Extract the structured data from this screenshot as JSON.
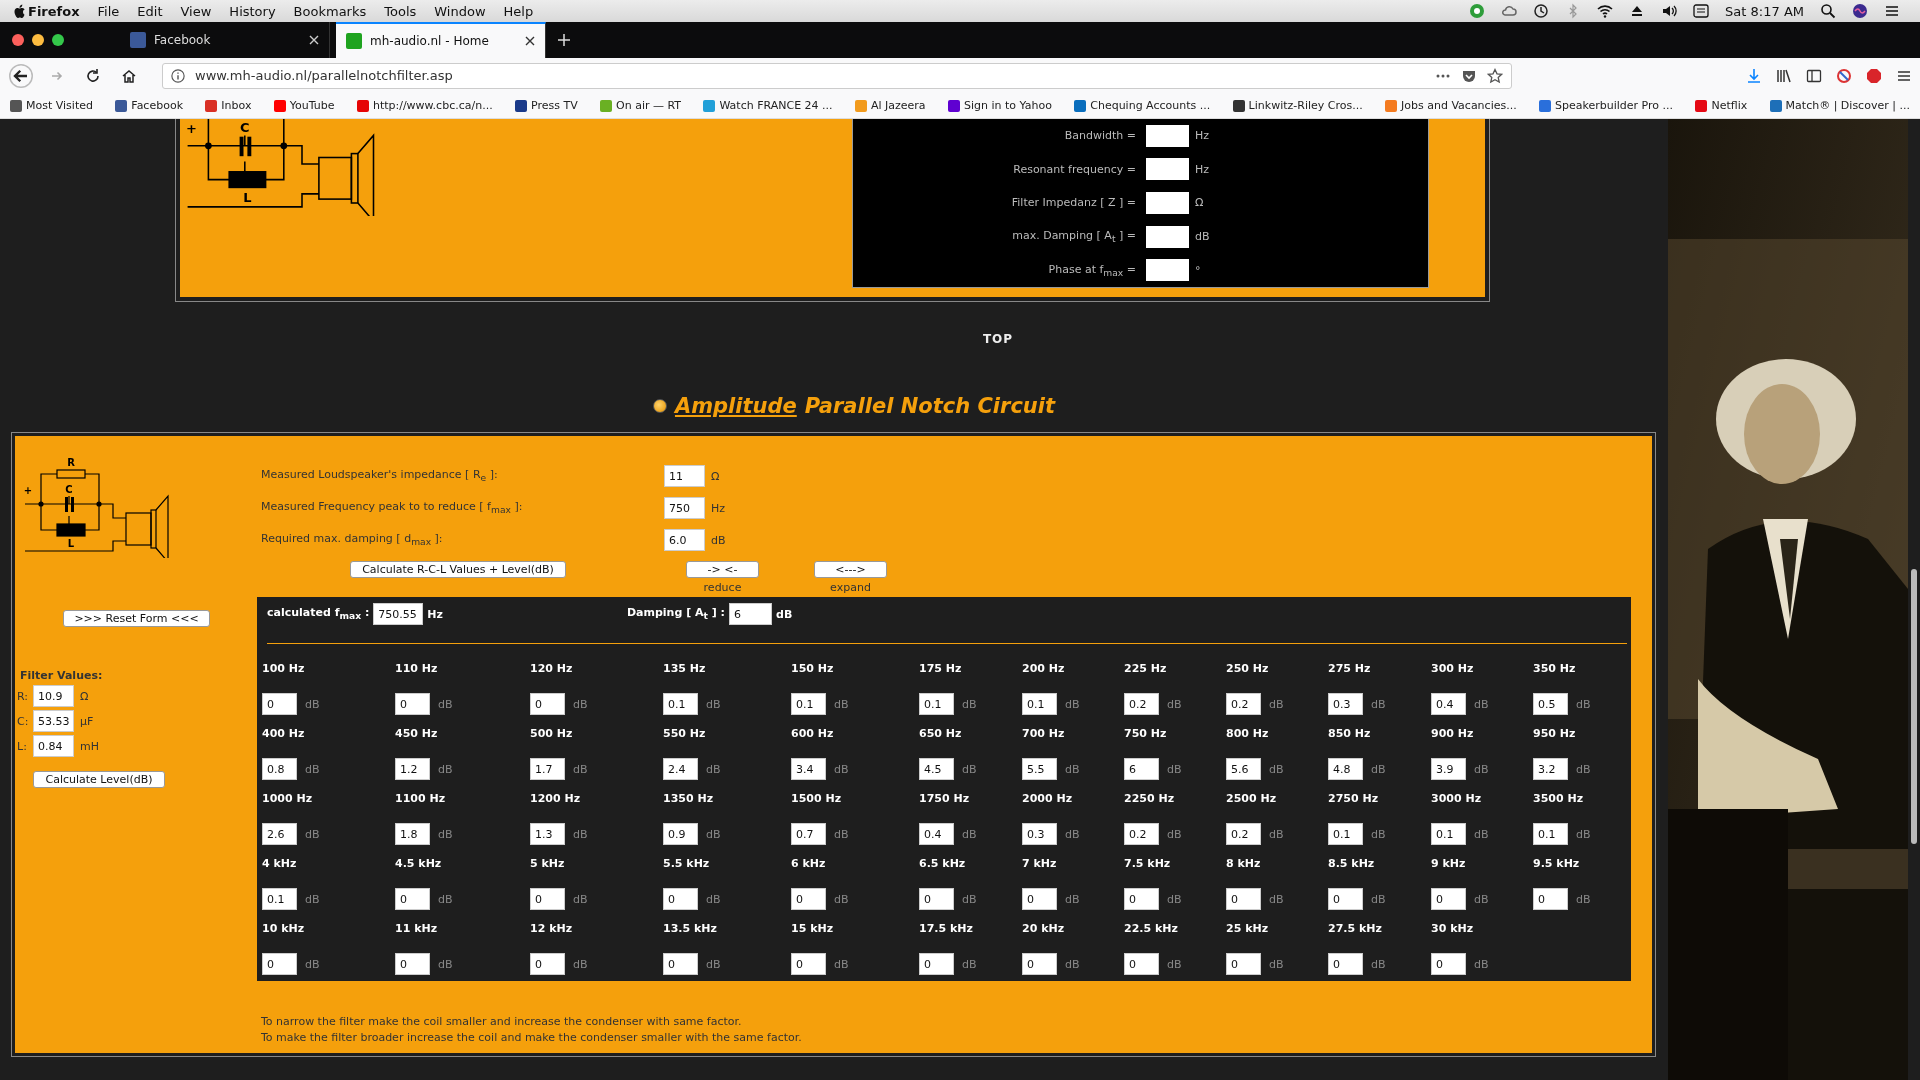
{
  "menubar": {
    "app": "Firefox",
    "menus": [
      "File",
      "Edit",
      "View",
      "History",
      "Bookmarks",
      "Tools",
      "Window",
      "Help"
    ],
    "clock": "Sat 8:17 AM"
  },
  "tabs": [
    {
      "title": "Facebook",
      "selected": false,
      "color": "#3b5998"
    },
    {
      "title": "mh-audio.nl - Home",
      "selected": true,
      "color": "#1fa31f"
    }
  ],
  "url": "www.mh-audio.nl/parallelnotchfilter.asp",
  "bookmarks": [
    {
      "label": "Most Visited",
      "color": "#555555"
    },
    {
      "label": "Facebook",
      "color": "#3b5998"
    },
    {
      "label": "Inbox",
      "color": "#d93025"
    },
    {
      "label": "YouTube",
      "color": "#ff0000"
    },
    {
      "label": "http://www.cbc.ca/n...",
      "color": "#e60505"
    },
    {
      "label": "Press TV",
      "color": "#1a3a8a"
    },
    {
      "label": "On air — RT",
      "color": "#6ab023"
    },
    {
      "label": "Watch FRANCE 24 ...",
      "color": "#22a0d8"
    },
    {
      "label": "Al Jazeera",
      "color": "#f29b1d"
    },
    {
      "label": "Sign in to Yahoo",
      "color": "#5f01d1"
    },
    {
      "label": "Chequing Accounts ...",
      "color": "#0a6ebd"
    },
    {
      "label": "Linkwitz-Riley Cros...",
      "color": "#333333"
    },
    {
      "label": "Jobs and Vacancies...",
      "color": "#f47b20"
    },
    {
      "label": "Speakerbuilder Pro ...",
      "color": "#2a6fdb"
    },
    {
      "label": "Netflix",
      "color": "#e50914"
    },
    {
      "label": "Match® | Discover | ...",
      "color": "#1d6fb8"
    }
  ],
  "top_section": {
    "circuit_labels": [
      {
        "kind": "terminal",
        "text": "+"
      },
      {
        "kind": "capacitor",
        "text": "C"
      },
      {
        "kind": "inductor",
        "text": "L"
      }
    ],
    "results": [
      {
        "label": "Bandwidth =",
        "unit": "Hz"
      },
      {
        "label": "Resonant frequency =",
        "unit": "Hz"
      },
      {
        "label": "Filter Impedanz [ Z ] =",
        "unit": "Ω"
      },
      {
        "label": "max. Damping [ A$_{t}$ ] =",
        "unit": "dB"
      },
      {
        "label": "Phase at f$_{max}$ =",
        "unit": "°"
      }
    ]
  },
  "top_link": "TOP",
  "heading": {
    "link": "Amplitude",
    "title": "Parallel Notch Circuit"
  },
  "calculator": {
    "circuit_labels": [
      {
        "kind": "resistor",
        "text": "R"
      },
      {
        "kind": "terminal",
        "text": "+"
      },
      {
        "kind": "capacitor",
        "text": "C"
      },
      {
        "kind": "inductor",
        "text": "L"
      }
    ],
    "inputs": [
      {
        "label": "Measured Loudspeaker's impedance [ R$_{e}$ ]:",
        "value": "11",
        "unit": "Ω"
      },
      {
        "label": "Measured Frequency peak to to reduce [ f$_{max}$ ]:",
        "value": "750",
        "unit": "Hz"
      },
      {
        "label": "Required max. damping [ d$_{max}$ ]:",
        "value": "6.0",
        "unit": "dB"
      }
    ],
    "calculate_button": "Calculate R-C-L Values + Level(dB)",
    "reduce": {
      "button": "-> <-",
      "caption": "reduce"
    },
    "expand": {
      "button": "<--->",
      "caption": "expand"
    },
    "reset_button": ">>> Reset Form <<<",
    "filter_values": {
      "title": "Filter Values:",
      "fields": [
        {
          "label": "R:",
          "value": "10.9",
          "unit": "Ω"
        },
        {
          "label": "C:",
          "value": "53.53",
          "unit": "µF"
        },
        {
          "label": "L:",
          "value": "0.84",
          "unit": "mH"
        }
      ],
      "button": "Calculate Level(dB)"
    },
    "fmax": {
      "label": "calculated f$_{max}$ :",
      "value": "750.55",
      "unit": "Hz"
    },
    "damping": {
      "label": "Damping [ A$_{t}$ ] :",
      "value": "6",
      "unit": "dB"
    },
    "levels": [
      [
        {
          "freq": "100 Hz",
          "value": "0",
          "unit": "dB"
        },
        {
          "freq": "110 Hz",
          "value": "0",
          "unit": "dB"
        },
        {
          "freq": "120 Hz",
          "value": "0",
          "unit": "dB"
        },
        {
          "freq": "135 Hz",
          "value": "0.1",
          "unit": "dB"
        },
        {
          "freq": "150 Hz",
          "value": "0.1",
          "unit": "dB"
        },
        {
          "freq": "175 Hz",
          "value": "0.1",
          "unit": "dB"
        },
        {
          "freq": "200 Hz",
          "value": "0.1",
          "unit": "dB"
        },
        {
          "freq": "225 Hz",
          "value": "0.2",
          "unit": "dB"
        },
        {
          "freq": "250 Hz",
          "value": "0.2",
          "unit": "dB"
        },
        {
          "freq": "275 Hz",
          "value": "0.3",
          "unit": "dB"
        },
        {
          "freq": "300 Hz",
          "value": "0.4",
          "unit": "dB"
        },
        {
          "freq": "350 Hz",
          "value": "0.5",
          "unit": "dB"
        }
      ],
      [
        {
          "freq": "400 Hz",
          "value": "0.8",
          "unit": "dB"
        },
        {
          "freq": "450 Hz",
          "value": "1.2",
          "unit": "dB"
        },
        {
          "freq": "500 Hz",
          "value": "1.7",
          "unit": "dB"
        },
        {
          "freq": "550 Hz",
          "value": "2.4",
          "unit": "dB"
        },
        {
          "freq": "600 Hz",
          "value": "3.4",
          "unit": "dB"
        },
        {
          "freq": "650 Hz",
          "value": "4.5",
          "unit": "dB"
        },
        {
          "freq": "700 Hz",
          "value": "5.5",
          "unit": "dB"
        },
        {
          "freq": "750 Hz",
          "value": "6",
          "unit": "dB"
        },
        {
          "freq": "800 Hz",
          "value": "5.6",
          "unit": "dB"
        },
        {
          "freq": "850 Hz",
          "value": "4.8",
          "unit": "dB"
        },
        {
          "freq": "900 Hz",
          "value": "3.9",
          "unit": "dB"
        },
        {
          "freq": "950 Hz",
          "value": "3.2",
          "unit": "dB"
        }
      ],
      [
        {
          "freq": "1000 Hz",
          "value": "2.6",
          "unit": "dB"
        },
        {
          "freq": "1100 Hz",
          "value": "1.8",
          "unit": "dB"
        },
        {
          "freq": "1200 Hz",
          "value": "1.3",
          "unit": "dB"
        },
        {
          "freq": "1350 Hz",
          "value": "0.9",
          "unit": "dB"
        },
        {
          "freq": "1500 Hz",
          "value": "0.7",
          "unit": "dB"
        },
        {
          "freq": "1750 Hz",
          "value": "0.4",
          "unit": "dB"
        },
        {
          "freq": "2000 Hz",
          "value": "0.3",
          "unit": "dB"
        },
        {
          "freq": "2250 Hz",
          "value": "0.2",
          "unit": "dB"
        },
        {
          "freq": "2500 Hz",
          "value": "0.2",
          "unit": "dB"
        },
        {
          "freq": "2750 Hz",
          "value": "0.1",
          "unit": "dB"
        },
        {
          "freq": "3000 Hz",
          "value": "0.1",
          "unit": "dB"
        },
        {
          "freq": "3500 Hz",
          "value": "0.1",
          "unit": "dB"
        }
      ],
      [
        {
          "freq": "4 kHz",
          "value": "0.1",
          "unit": "dB"
        },
        {
          "freq": "4.5 kHz",
          "value": "0",
          "unit": "dB"
        },
        {
          "freq": "5 kHz",
          "value": "0",
          "unit": "dB"
        },
        {
          "freq": "5.5 kHz",
          "value": "0",
          "unit": "dB"
        },
        {
          "freq": "6 kHz",
          "value": "0",
          "unit": "dB"
        },
        {
          "freq": "6.5 kHz",
          "value": "0",
          "unit": "dB"
        },
        {
          "freq": "7 kHz",
          "value": "0",
          "unit": "dB"
        },
        {
          "freq": "7.5 kHz",
          "value": "0",
          "unit": "dB"
        },
        {
          "freq": "8 kHz",
          "value": "0",
          "unit": "dB"
        },
        {
          "freq": "8.5 kHz",
          "value": "0",
          "unit": "dB"
        },
        {
          "freq": "9 kHz",
          "value": "0",
          "unit": "dB"
        },
        {
          "freq": "9.5 kHz",
          "value": "0",
          "unit": "dB"
        }
      ],
      [
        {
          "freq": "10 kHz",
          "value": "0",
          "unit": "dB"
        },
        {
          "freq": "11 kHz",
          "value": "0",
          "unit": "dB"
        },
        {
          "freq": "12 kHz",
          "value": "0",
          "unit": "dB"
        },
        {
          "freq": "13.5 kHz",
          "value": "0",
          "unit": "dB"
        },
        {
          "freq": "15 kHz",
          "value": "0",
          "unit": "dB"
        },
        {
          "freq": "17.5 kHz",
          "value": "0",
          "unit": "dB"
        },
        {
          "freq": "20 kHz",
          "value": "0",
          "unit": "dB"
        },
        {
          "freq": "22.5 kHz",
          "value": "0",
          "unit": "dB"
        },
        {
          "freq": "25 kHz",
          "value": "0",
          "unit": "dB"
        },
        {
          "freq": "27.5 kHz",
          "value": "0",
          "unit": "dB"
        },
        {
          "freq": "30 kHz",
          "value": "0",
          "unit": "dB"
        }
      ]
    ],
    "notes": [
      "To narrow the filter make the coil smaller and increase the condenser with same factor.",
      "To make the filter broader increase the coil and make the condenser smaller with the same factor."
    ]
  }
}
